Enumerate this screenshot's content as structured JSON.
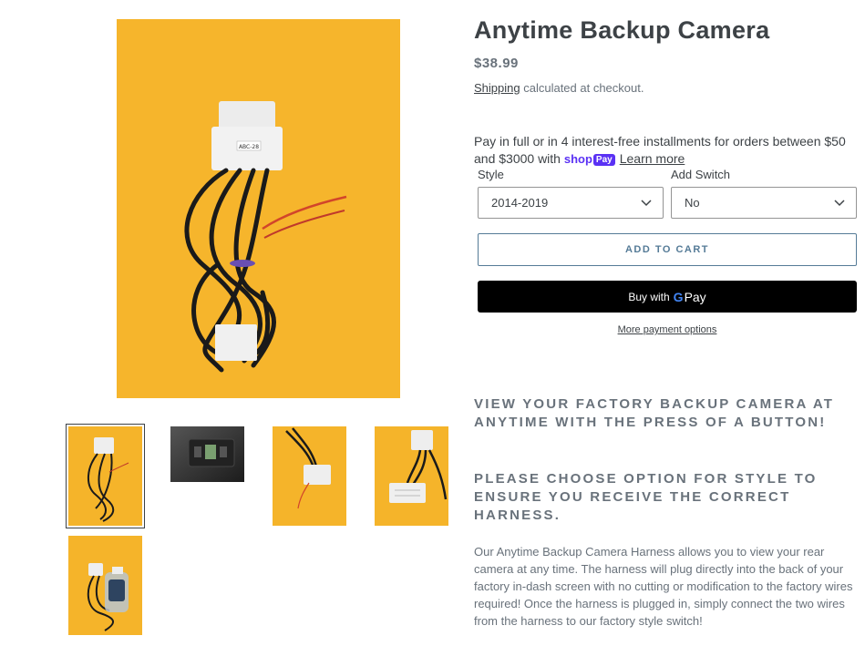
{
  "product": {
    "title": "Anytime Backup Camera",
    "price": "$38.99",
    "shipping_link": "Shipping",
    "shipping_rest": " calculated at checkout."
  },
  "installments": {
    "text": "Pay in full or in 4 interest-free installments for orders between $50 and $3000 with ",
    "shoppay_shop": "shop",
    "shoppay_pay": "Pay",
    "learn_more": "Learn more"
  },
  "options": {
    "style_label": "Style",
    "style_value": "2014-2019",
    "switch_label": "Add Switch",
    "switch_value": "No"
  },
  "buttons": {
    "add_to_cart": "ADD TO CART",
    "gpay_prefix": "Buy with",
    "gpay_g": "G",
    "gpay_pay": "Pay",
    "more_options": "More payment options"
  },
  "description": {
    "heading1": "VIEW YOUR FACTORY BACKUP CAMERA AT ANYTIME WITH THE PRESS OF A BUTTON!",
    "heading2": "PLEASE CHOOSE OPTION FOR STYLE TO ENSURE YOU RECEIVE THE CORRECT HARNESS.",
    "body": "Our Anytime Backup Camera Harness allows you to view your rear camera at any time. The harness will plug directly into the back of your factory in-dash screen with no cutting or modification to the factory wires required! Once the harness is plugged in, simply connect the two wires from the harness to our factory style switch!"
  },
  "media": {
    "main_image_label": "ABC-28",
    "thumbnails": [
      "harness-thumb-1",
      "switch-panel-thumb",
      "harness-thumb-3",
      "harness-thumb-4",
      "harness-thumb-5"
    ]
  },
  "colors": {
    "background_yellow": "#f5b42a",
    "button_outline": "#557b97",
    "text_dark": "#3d4246",
    "text_muted": "#69727b",
    "shoppay": "#5a31f4"
  }
}
